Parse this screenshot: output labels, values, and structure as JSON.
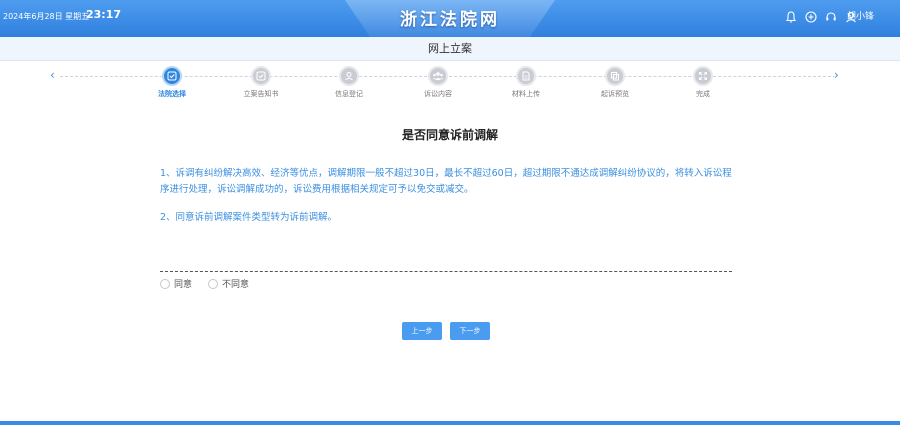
{
  "header": {
    "date": "2024年6月28日 星期五",
    "time": "23:17",
    "site_title": "浙江法院网",
    "user_name": "胡小锋",
    "icons": [
      "bell-icon",
      "plus-circle-icon",
      "headset-icon",
      "user-icon"
    ]
  },
  "page": {
    "title": "网上立案"
  },
  "steps": [
    {
      "label": "法院选择",
      "icon": "check-icon",
      "active": true
    },
    {
      "label": "立案告知书",
      "icon": "check-icon",
      "active": false
    },
    {
      "label": "信息登记",
      "icon": "person-icon",
      "active": false
    },
    {
      "label": "诉讼内容",
      "icon": "group-icon",
      "active": false
    },
    {
      "label": "材料上传",
      "icon": "document-icon",
      "active": false
    },
    {
      "label": "起诉预览",
      "icon": "copy-icon",
      "active": false
    },
    {
      "label": "完成",
      "icon": "expand-icon",
      "active": false
    }
  ],
  "content": {
    "title": "是否同意诉前调解",
    "para1": "1、诉调有纠纷解决高效、经济等优点，调解期限一般不超过30日，最长不超过60日，超过期限不通达成调解纠纷协议的，将转入诉讼程序进行处理，诉讼调解成功的，诉讼费用根据相关规定可予以免交或减交。",
    "para2": "2、同意诉前调解案件类型转为诉前调解。"
  },
  "options": {
    "agree": "同意",
    "disagree": "不同意"
  },
  "buttons": {
    "prev": "上一步",
    "next": "下一步"
  },
  "colors": {
    "primary": "#2e86de",
    "header": "#3d8de8",
    "text_blue": "#3b8fe0"
  }
}
